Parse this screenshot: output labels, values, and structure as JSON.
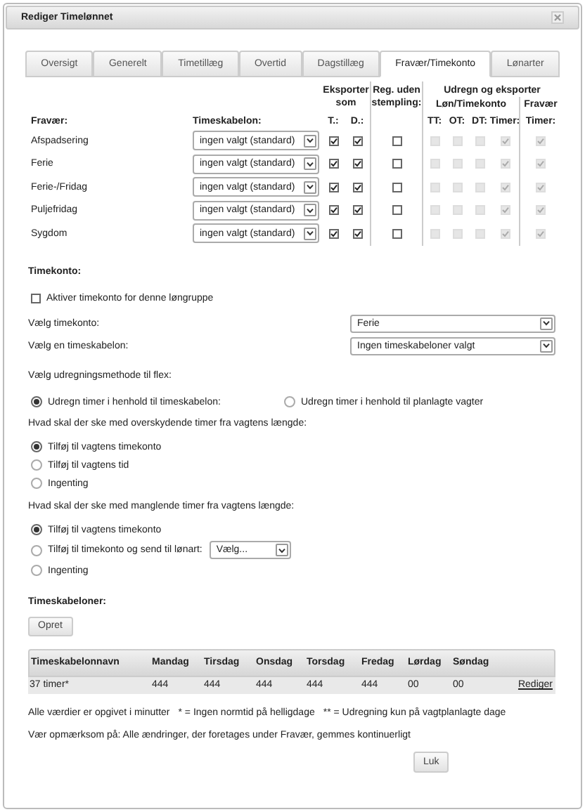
{
  "window": {
    "title": "Rediger Timelønnet"
  },
  "tabs": [
    {
      "label": "Oversigt",
      "selected": false
    },
    {
      "label": "Generelt",
      "selected": false
    },
    {
      "label": "Timetillæg",
      "selected": false
    },
    {
      "label": "Overtid",
      "selected": false
    },
    {
      "label": "Dagstillæg",
      "selected": false
    },
    {
      "label": "Fravær/Timekonto",
      "selected": true
    },
    {
      "label": "Lønarter",
      "selected": false
    }
  ],
  "absence_table": {
    "group_headers": {
      "export": "Eksporter som",
      "reg": "Reg. uden stempling:",
      "calc": "Udregn og eksporter",
      "calc_sub": "Løn/Timekonto",
      "absence": "Fravær"
    },
    "columns": [
      "Fravær:",
      "Timeskabelon:",
      "T.:",
      "D.:",
      "TT:",
      "OT:",
      "DT:",
      "Timer:",
      "Timer:"
    ],
    "rows": [
      {
        "name": "Afspadsering",
        "template": "ingen valgt (standard)",
        "checks": [
          {
            "checked": true,
            "disabled": false
          },
          {
            "checked": true,
            "disabled": false
          },
          {
            "checked": false,
            "disabled": false
          },
          {
            "checked": false,
            "disabled": true
          },
          {
            "checked": false,
            "disabled": true
          },
          {
            "checked": false,
            "disabled": true
          },
          {
            "checked": true,
            "disabled": true
          },
          {
            "checked": true,
            "disabled": true
          }
        ]
      },
      {
        "name": "Ferie",
        "template": "ingen valgt (standard)",
        "checks": [
          {
            "checked": true,
            "disabled": false
          },
          {
            "checked": true,
            "disabled": false
          },
          {
            "checked": false,
            "disabled": false
          },
          {
            "checked": false,
            "disabled": true
          },
          {
            "checked": false,
            "disabled": true
          },
          {
            "checked": false,
            "disabled": true
          },
          {
            "checked": true,
            "disabled": true
          },
          {
            "checked": true,
            "disabled": true
          }
        ]
      },
      {
        "name": "Ferie-/Fridag",
        "template": "ingen valgt (standard)",
        "checks": [
          {
            "checked": true,
            "disabled": false
          },
          {
            "checked": true,
            "disabled": false
          },
          {
            "checked": false,
            "disabled": false
          },
          {
            "checked": false,
            "disabled": true
          },
          {
            "checked": false,
            "disabled": true
          },
          {
            "checked": false,
            "disabled": true
          },
          {
            "checked": true,
            "disabled": true
          },
          {
            "checked": true,
            "disabled": true
          }
        ]
      },
      {
        "name": "Puljefridag",
        "template": "ingen valgt (standard)",
        "checks": [
          {
            "checked": true,
            "disabled": false
          },
          {
            "checked": true,
            "disabled": false
          },
          {
            "checked": false,
            "disabled": false
          },
          {
            "checked": false,
            "disabled": true
          },
          {
            "checked": false,
            "disabled": true
          },
          {
            "checked": false,
            "disabled": true
          },
          {
            "checked": true,
            "disabled": true
          },
          {
            "checked": true,
            "disabled": true
          }
        ]
      },
      {
        "name": "Sygdom",
        "template": "ingen valgt (standard)",
        "checks": [
          {
            "checked": true,
            "disabled": false
          },
          {
            "checked": true,
            "disabled": false
          },
          {
            "checked": false,
            "disabled": false
          },
          {
            "checked": false,
            "disabled": true
          },
          {
            "checked": false,
            "disabled": true
          },
          {
            "checked": false,
            "disabled": true
          },
          {
            "checked": true,
            "disabled": true
          },
          {
            "checked": true,
            "disabled": true
          }
        ]
      }
    ]
  },
  "timekonto": {
    "title": "Timekonto:",
    "activate": {
      "label": "Aktiver timekonto for denne løngruppe",
      "checked": false
    },
    "fields": [
      {
        "label": "Vælg timekonto:",
        "value": "Ferie"
      },
      {
        "label": "Vælg en timeskabelon:",
        "value": "Ingen timeskabeloner valgt"
      }
    ],
    "flex_method": {
      "question": "Vælg udregningsmethode til flex:",
      "options": [
        {
          "label": "Udregn timer i henhold til timeskabelon:",
          "selected": true
        },
        {
          "label": "Udregn timer i henhold til planlagte vagter",
          "selected": false
        }
      ]
    },
    "excess": {
      "question": "Hvad skal der ske med overskydende timer fra vagtens længde:",
      "options": [
        {
          "label": "Tilføj til vagtens timekonto",
          "selected": true
        },
        {
          "label": "Tilføj til vagtens tid",
          "selected": false
        },
        {
          "label": "Ingenting",
          "selected": false
        }
      ]
    },
    "missing": {
      "question": "Hvad skal der ske med manglende timer fra vagtens længde:",
      "options": [
        {
          "label": "Tilføj til vagtens timekonto",
          "selected": true
        },
        {
          "label": "Tilføj til timekonto og send til lønart:",
          "selected": false,
          "select": "Vælg..."
        },
        {
          "label": "Ingenting",
          "selected": false
        }
      ]
    }
  },
  "templates": {
    "title": "Timeskabeloner:",
    "create_button": "Opret",
    "columns": [
      "Timeskabelonnavn",
      "Mandag",
      "Tirsdag",
      "Onsdag",
      "Torsdag",
      "Fredag",
      "Lørdag",
      "Søndag"
    ],
    "rows": [
      {
        "cells": [
          "37 timer*",
          "444",
          "444",
          "444",
          "444",
          "444",
          "00",
          "00"
        ],
        "link": "Rediger"
      }
    ]
  },
  "legend": [
    "Alle værdier er opgivet i minutter",
    "* = Ingen normtid på helligdage",
    "** = Udregning kun på vagtplanlagte dage"
  ],
  "note": "Vær opmærksom på: Alle ændringer, der foretages under Fravær, gemmes kontinuerligt",
  "close_button": "Luk"
}
